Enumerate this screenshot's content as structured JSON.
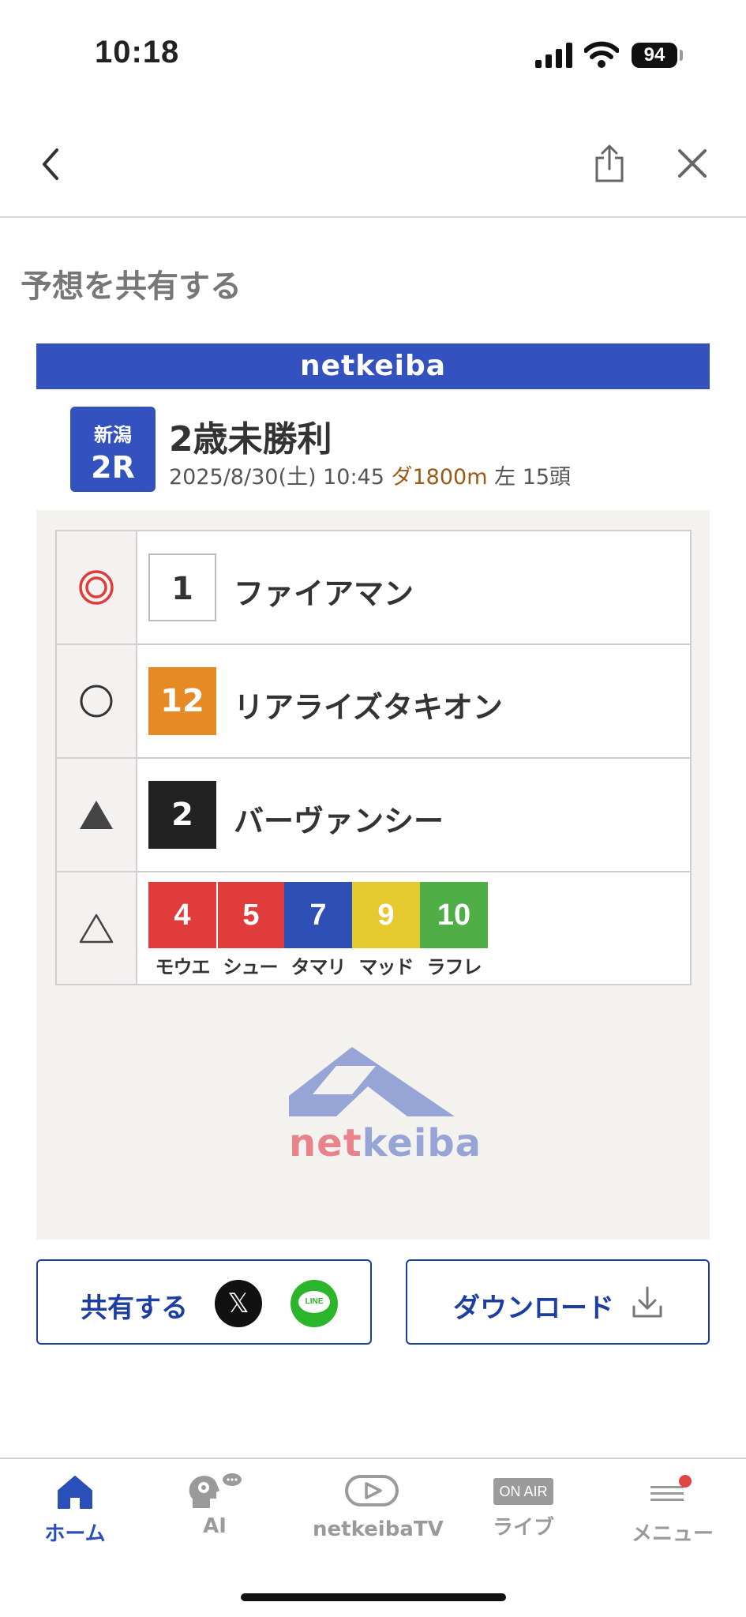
{
  "status_bar": {
    "time": "10:18",
    "battery": "94"
  },
  "page": {
    "heading": "予想を共有する"
  },
  "card": {
    "header_logo": "netkeiba",
    "race": {
      "venue": "新潟",
      "race_no": "2R",
      "title": "2歳未勝利",
      "datetime": "2025/8/30(土) 10:45",
      "course": "ダ1800m",
      "direction": "左",
      "runners": "15頭"
    },
    "predictions": [
      {
        "mark": "double-circle",
        "number": "1",
        "name": "ファイアマン",
        "bg": "#ffffff",
        "fg": "#333333"
      },
      {
        "mark": "circle",
        "number": "12",
        "name": "リアライズタキオン",
        "bg": "#e68a25",
        "fg": "#ffffff"
      },
      {
        "mark": "filled-triangle",
        "number": "2",
        "name": "バーヴァンシー",
        "bg": "#222222",
        "fg": "#ffffff"
      }
    ],
    "delta_picks": [
      {
        "number": "4",
        "name": "モウエ",
        "bg": "#e03c3c"
      },
      {
        "number": "5",
        "name": "シュー",
        "bg": "#e03c3c"
      },
      {
        "number": "7",
        "name": "タマリ",
        "bg": "#2e4fb5"
      },
      {
        "number": "9",
        "name": "マッド",
        "bg": "#e6c82f"
      },
      {
        "number": "10",
        "name": "ラフレ",
        "bg": "#4fae45"
      }
    ],
    "footer_logo": {
      "part1": "net",
      "part2": "keiba"
    }
  },
  "actions": {
    "share_label": "共有する",
    "x_label": "𝕏",
    "line_label": "LINE",
    "download_label": "ダウンロード"
  },
  "tab_bar": {
    "items": [
      {
        "label": "ホーム",
        "icon": "home-icon"
      },
      {
        "label": "AI",
        "icon": "ai-icon"
      },
      {
        "label": "netkeibaTV",
        "icon": "play-icon"
      },
      {
        "label": "ライブ",
        "icon": "on-air-icon",
        "badge_text": "ON AIR"
      },
      {
        "label": "メニュー",
        "icon": "menu-icon"
      }
    ]
  },
  "colors": {
    "brand_blue": "#3451c0",
    "button_blue": "#1c3da2",
    "mark_red": "#e03c3c"
  }
}
